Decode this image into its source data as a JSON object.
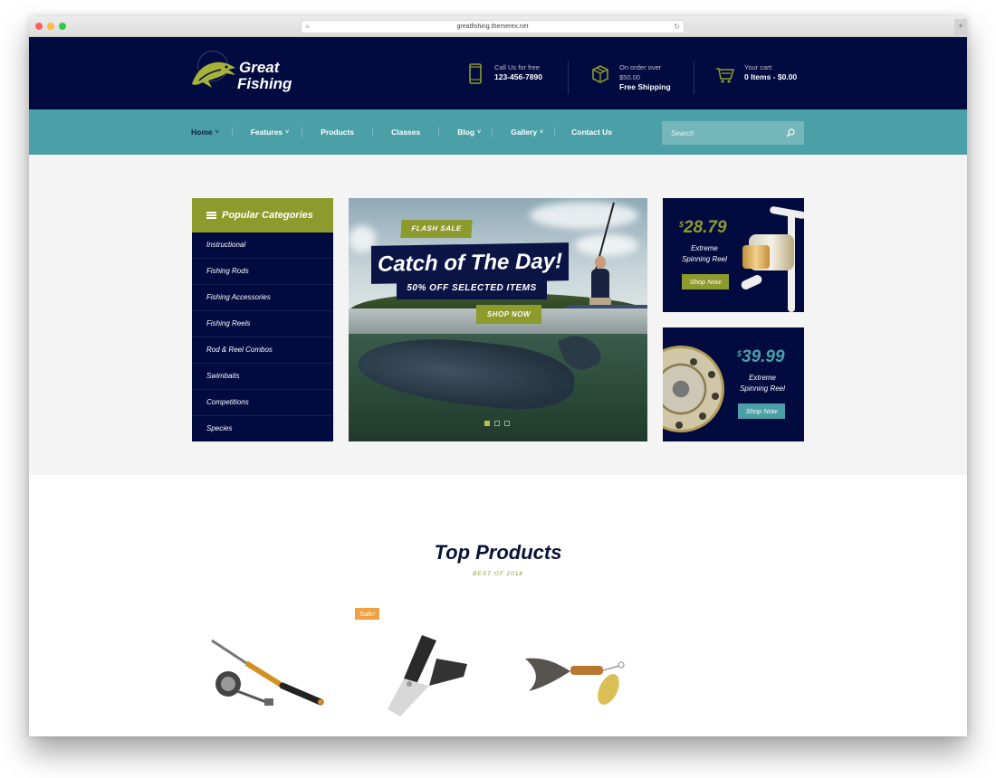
{
  "browser": {
    "url": "greatfishing.themerex.net",
    "new_tab_label": "+"
  },
  "header": {
    "logo_line1": "Great",
    "logo_line2": "Fishing",
    "phone": {
      "label": "Call Us for free",
      "value": "123-456-7890",
      "icon": "phone-icon"
    },
    "shipping": {
      "label": "On order over",
      "amount": "$50.00",
      "value": "Free Shipping",
      "icon": "box-icon"
    },
    "cart": {
      "label": "Your cart:",
      "value": "0 Items - $0.00",
      "icon": "cart-icon"
    }
  },
  "nav": {
    "items": [
      {
        "label": "Home",
        "has_dropdown": true,
        "active": true
      },
      {
        "label": "Features",
        "has_dropdown": true
      },
      {
        "label": "Products",
        "has_dropdown": false
      },
      {
        "label": "Classes",
        "has_dropdown": false
      },
      {
        "label": "Blog",
        "has_dropdown": true
      },
      {
        "label": "Gallery",
        "has_dropdown": true
      },
      {
        "label": "Contact Us",
        "has_dropdown": false
      }
    ],
    "search_placeholder": "Search"
  },
  "categories": {
    "title": "Popular Categories",
    "items": [
      "Instructional",
      "Fishing Rods",
      "Fishing Accessories",
      "Fishing Reels",
      "Rod & Reel Combos",
      "Swimbaits",
      "Competitions",
      "Species"
    ]
  },
  "slider": {
    "badge": "FLASH SALE",
    "title": "Catch of The Day!",
    "subtitle": "50% OFF SELECTED ITEMS",
    "cta": "SHOP NOW",
    "slides": 3,
    "active_slide": 1
  },
  "promos": [
    {
      "currency": "$",
      "price": "28.79",
      "name_line1": "Extreme",
      "name_line2": "Spinning Reel",
      "cta": "Shop Now",
      "accent": "#8d9a2c"
    },
    {
      "currency": "$",
      "price": "39.99",
      "name_line1": "Extreme",
      "name_line2": "Spinning Reel",
      "cta": "Shop Now",
      "accent": "#4aa0a6"
    }
  ],
  "top_products": {
    "title": "Top Products",
    "subtitle": "BEST OF 2018",
    "items": [
      {
        "name": "telescopic-rod-combo",
        "badge": null
      },
      {
        "name": "multi-tool-pliers",
        "badge": "Sale!"
      },
      {
        "name": "spinner-lure",
        "badge": null
      }
    ]
  },
  "colors": {
    "navy": "#020b40",
    "teal": "#4aa0a6",
    "olive": "#8d9a2c",
    "sale_orange": "#f0a042"
  }
}
